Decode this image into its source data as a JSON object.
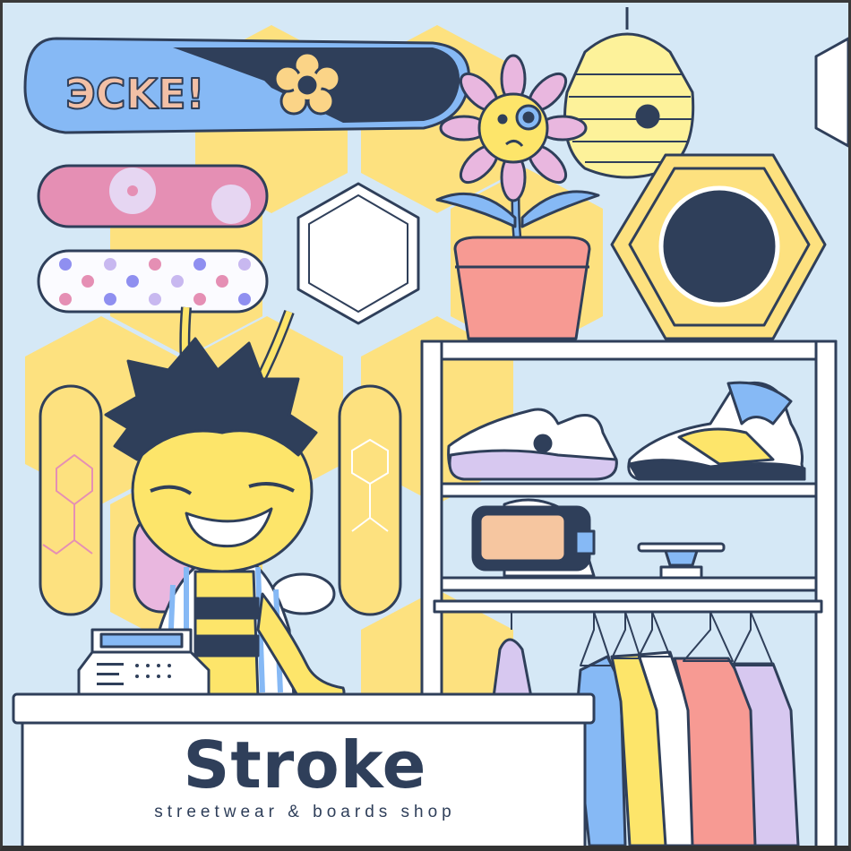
{
  "shop": {
    "name": "Stroke",
    "tagline": "streetwear & boards shop"
  },
  "snowboard_logo_text": "illegible stylized lettering",
  "colors": {
    "background": "#d5e8f6",
    "honeycomb": "#fde17f",
    "navy": "#2f3f5a",
    "pink": "#e58fb4",
    "blue": "#86b9f5",
    "pot": "#f79a93"
  }
}
